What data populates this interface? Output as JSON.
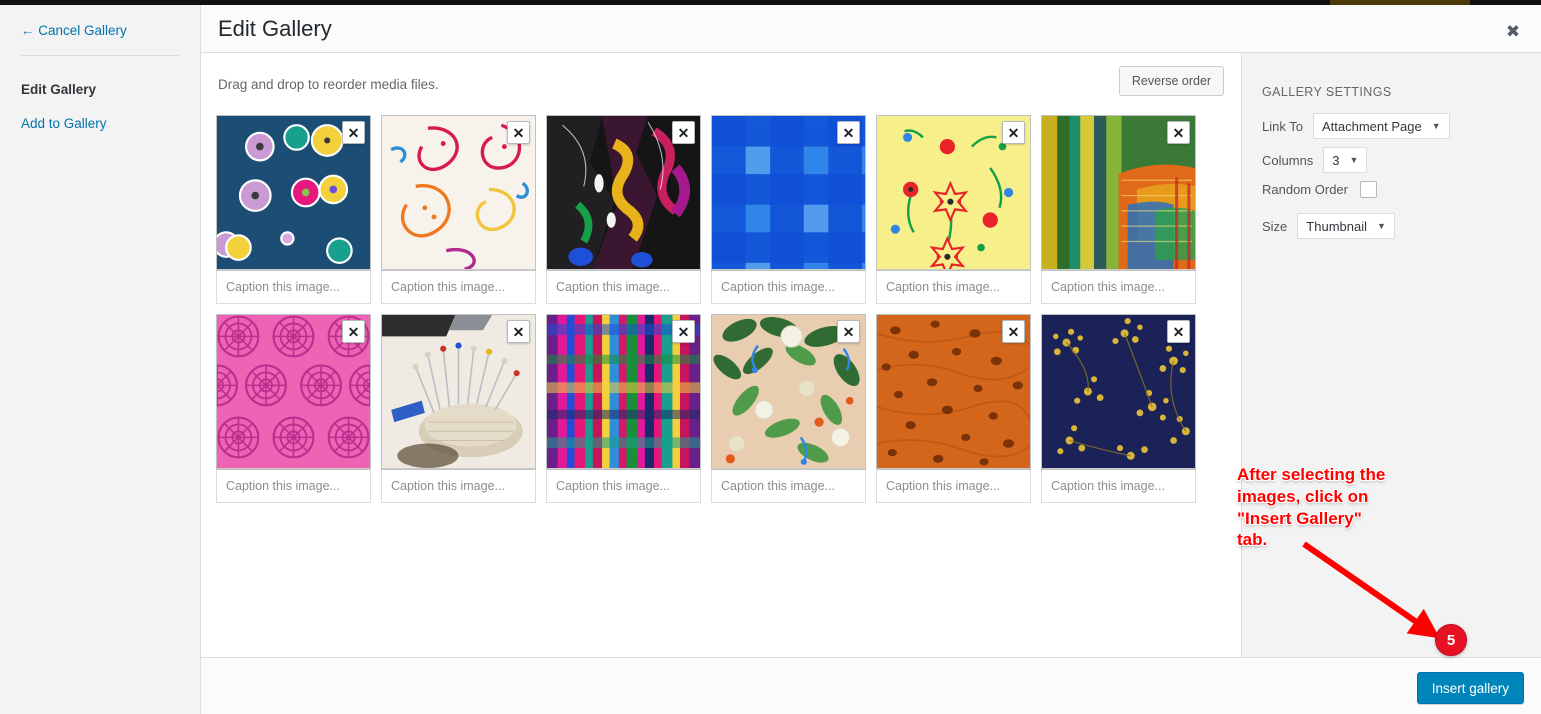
{
  "window": {
    "title": "Edit Gallery",
    "close_icon": "close-icon",
    "close_glyph": "✖"
  },
  "sidebar": {
    "cancel_label": "← Cancel Gallery",
    "items": [
      {
        "label": "Edit Gallery",
        "active": true
      },
      {
        "label": "Add to Gallery",
        "active": false
      }
    ]
  },
  "toolbar": {
    "drag_hint": "Drag and drop to reorder media files.",
    "reverse_order_label": "Reverse order"
  },
  "gallery": {
    "caption_placeholder": "Caption this image...",
    "remove_glyph": "✕",
    "tiles": [
      {
        "id": 1,
        "alt": "blue floral fabric",
        "caption": ""
      },
      {
        "id": 2,
        "alt": "paisley print fabric",
        "caption": ""
      },
      {
        "id": 3,
        "alt": "dark multicolor embroidery",
        "caption": ""
      },
      {
        "id": 4,
        "alt": "blue gingham check",
        "caption": ""
      },
      {
        "id": 5,
        "alt": "yellow daisy print",
        "caption": ""
      },
      {
        "id": 6,
        "alt": "knitted colorful textile",
        "caption": ""
      },
      {
        "id": 7,
        "alt": "pink mandala pattern",
        "caption": ""
      },
      {
        "id": 8,
        "alt": "pincushion with pins",
        "caption": ""
      },
      {
        "id": 9,
        "alt": "bright plaid weave",
        "caption": ""
      },
      {
        "id": 10,
        "alt": "botanical floral on beige",
        "caption": ""
      },
      {
        "id": 11,
        "alt": "orange spotted texture",
        "caption": ""
      },
      {
        "id": 12,
        "alt": "navy with gold blossoms",
        "caption": ""
      }
    ]
  },
  "settings": {
    "heading": "GALLERY SETTINGS",
    "link_to": {
      "label": "Link To",
      "value": "Attachment Page"
    },
    "columns": {
      "label": "Columns",
      "value": "3"
    },
    "random_order": {
      "label": "Random Order",
      "checked": false
    },
    "size": {
      "label": "Size",
      "value": "Thumbnail"
    },
    "caret_glyph": "▼"
  },
  "footer": {
    "insert_label": "Insert gallery"
  },
  "annotation": {
    "text": "After selecting the\nimages, click on\n\"Insert Gallery\"\ntab.",
    "badge": "5",
    "color": "#ff0000",
    "badge_color": "#e81123"
  }
}
